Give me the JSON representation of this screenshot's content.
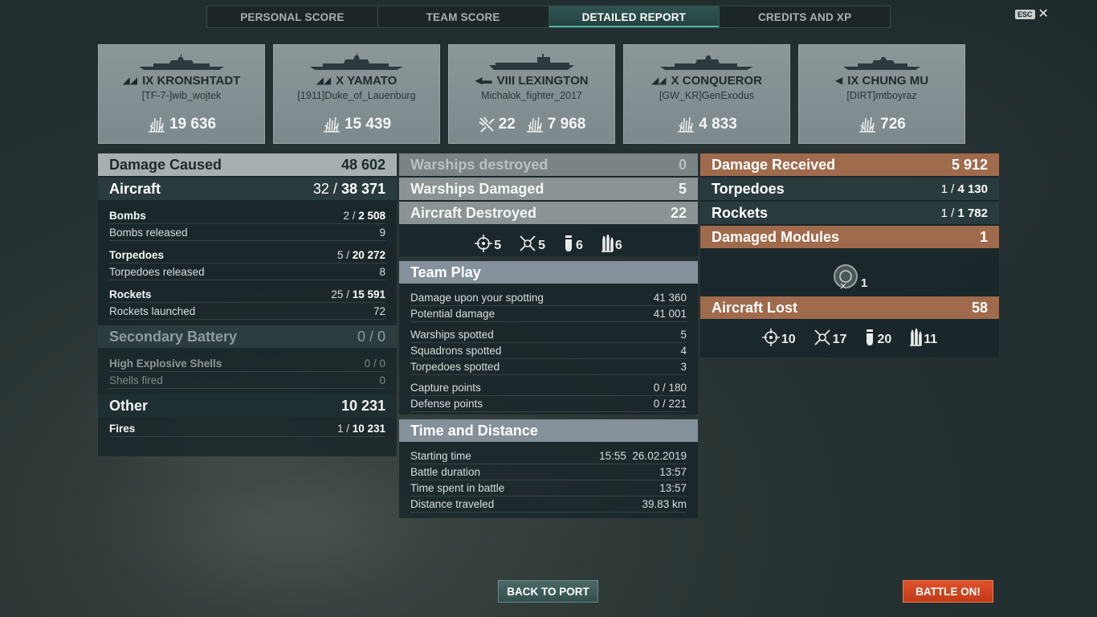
{
  "tabs": [
    {
      "label": "PERSONAL SCORE"
    },
    {
      "label": "TEAM SCORE"
    },
    {
      "label": "DETAILED REPORT"
    },
    {
      "label": "CREDITS AND XP"
    }
  ],
  "esc": {
    "key": "ESC",
    "close": "✕"
  },
  "ships": [
    {
      "tier": "IX",
      "name": "KRONSHTADT",
      "player": "[TF-7-]wib_wojtek",
      "damage": "19 636"
    },
    {
      "tier": "X",
      "name": "YAMATO",
      "player": "[1911]Duke_of_Lauenburg",
      "damage": "15 439"
    },
    {
      "tier": "VIII",
      "name": "LEXINGTON",
      "player": "Michalok_fighter_2017",
      "planes": "22",
      "damage": "7 968"
    },
    {
      "tier": "X",
      "name": "CONQUEROR",
      "player": "[GW_KR]GenExodus",
      "damage": "4 833"
    },
    {
      "tier": "IX",
      "name": "CHUNG MU",
      "player": "[DIRT]mtboyraz",
      "damage": "726"
    }
  ],
  "left": {
    "damage_caused": {
      "label": "Damage Caused",
      "value": "48 602"
    },
    "aircraft": {
      "label": "Aircraft",
      "hits": "32 / ",
      "value": "38 371"
    },
    "bombs": {
      "label": "Bombs",
      "hits": "2 / ",
      "value": "2 508"
    },
    "bombs_released": {
      "label": "Bombs released",
      "value": "9"
    },
    "torpedoes": {
      "label": "Torpedoes",
      "hits": "5 / ",
      "value": "20 272"
    },
    "torpedoes_released": {
      "label": "Torpedoes released",
      "value": "8"
    },
    "rockets": {
      "label": "Rockets",
      "hits": "25 / ",
      "value": "15 591"
    },
    "rockets_launched": {
      "label": "Rockets launched",
      "value": "72"
    },
    "secondary": {
      "label": "Secondary Battery",
      "value": "0 / 0"
    },
    "he_shells": {
      "label": "High Explosive Shells",
      "value": "0 / 0"
    },
    "shells_fired": {
      "label": "Shells fired",
      "value": "0"
    },
    "other": {
      "label": "Other",
      "value": "10 231"
    },
    "fires": {
      "label": "Fires",
      "hits": "1 / ",
      "value": "10 231"
    }
  },
  "middle": {
    "warships_destroyed": {
      "label": "Warships destroyed",
      "value": "0"
    },
    "warships_damaged": {
      "label": "Warships Damaged",
      "value": "5"
    },
    "aircraft_destroyed": {
      "label": "Aircraft Destroyed",
      "value": "22"
    },
    "aircraft_icons": [
      {
        "icon": "fighter-icon",
        "value": "5"
      },
      {
        "icon": "dive-bomber-icon",
        "value": "5"
      },
      {
        "icon": "bomb-icon",
        "value": "6"
      },
      {
        "icon": "rocket-icon",
        "value": "6"
      }
    ],
    "team_play": {
      "label": "Team Play"
    },
    "damage_spotting": {
      "label": "Damage upon your spotting",
      "value": "41 360"
    },
    "potential_damage": {
      "label": "Potential damage",
      "value": "41 001"
    },
    "warships_spotted": {
      "label": "Warships spotted",
      "value": "5"
    },
    "squadrons_spotted": {
      "label": "Squadrons spotted",
      "value": "4"
    },
    "torpedoes_spotted": {
      "label": "Torpedoes spotted",
      "value": "3"
    },
    "capture_points": {
      "label": "Capture points",
      "value": "0 / 180"
    },
    "defense_points": {
      "label": "Defense points",
      "value": "0 / 221"
    },
    "time_distance": {
      "label": "Time and Distance"
    },
    "starting_time": {
      "label": "Starting time",
      "value": "15:55  26.02.2019"
    },
    "battle_duration": {
      "label": "Battle duration",
      "value": "13:57"
    },
    "time_in_battle": {
      "label": "Time spent in battle",
      "value": "13:57"
    },
    "distance": {
      "label": "Distance traveled",
      "value": "39.83 km"
    }
  },
  "right": {
    "damage_received": {
      "label": "Damage Received",
      "value": "5 912"
    },
    "torpedoes": {
      "label": "Torpedoes",
      "hits": "1 / ",
      "value": "4 130"
    },
    "rockets": {
      "label": "Rockets",
      "hits": "1 / ",
      "value": "1 782"
    },
    "damaged_modules": {
      "label": "Damaged Modules",
      "value": "1"
    },
    "module_count": "1",
    "aircraft_lost": {
      "label": "Aircraft Lost",
      "value": "58"
    },
    "lost_icons": [
      {
        "icon": "fighter-icon",
        "value": "10"
      },
      {
        "icon": "dive-bomber-icon",
        "value": "17"
      },
      {
        "icon": "bomb-icon",
        "value": "20"
      },
      {
        "icon": "rocket-icon",
        "value": "11"
      }
    ]
  },
  "buttons": {
    "back": "BACK TO PORT",
    "battle": "BATTLE ON!"
  }
}
